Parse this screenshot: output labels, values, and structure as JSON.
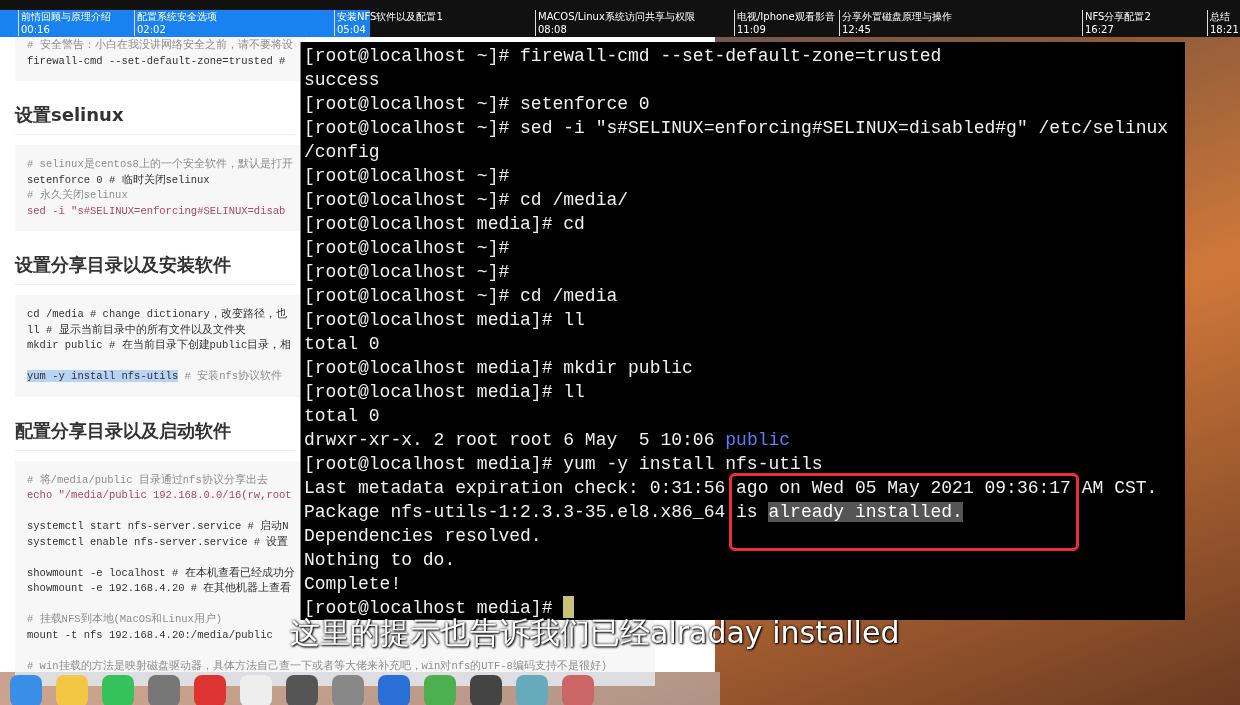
{
  "chapter_bar": {
    "level": 0.298,
    "chapters": [
      {
        "title": "前情回顾与原理介绍",
        "time": "00:16"
      },
      {
        "title": "配置系统安全选项",
        "time": "02:02"
      },
      {
        "title": "安装NFS软件以及配置1",
        "time": "05:04"
      },
      {
        "title": "MACOS/Linux系统访问共享与权限",
        "time": "08:08"
      },
      {
        "title": "电视/Iphone观看影音",
        "time": "11:09"
      },
      {
        "title": "分享外置磁盘原理与操作",
        "time": "12:45"
      },
      {
        "title": "NFS分享配置2",
        "time": "16:27"
      },
      {
        "title": "总结",
        "time": "18:21"
      }
    ]
  },
  "document": {
    "sections": [
      {
        "lines": [
          {
            "kind": "comment",
            "text": "# 安全警告：小白在我没讲网络安全之前，请不要将设",
            "selected": false
          },
          {
            "kind": "code",
            "text": "firewall-cmd --set-default-zone=trusted #",
            "selected": false
          }
        ]
      },
      {
        "heading": "设置selinux",
        "lines": [
          {
            "kind": "comment",
            "text": "# selinux是centos8上的一个安全软件，默认是打开",
            "selected": false
          },
          {
            "kind": "code",
            "text": "setenforce 0 # 临时关闭selinux",
            "selected": false
          },
          {
            "kind": "comment",
            "text": "# 永久关闭selinux",
            "selected": false
          },
          {
            "kind": "string",
            "text": "sed -i \"s#SELINUX=enforcing#SELINUX=disab",
            "selected": false
          }
        ]
      },
      {
        "heading": "设置分享目录以及安装软件",
        "lines": [
          {
            "kind": "code",
            "text": "cd /media  # change dictionary，改变路径，也",
            "selected": false
          },
          {
            "kind": "code",
            "text": "ll # 显示当前目录中的所有文件以及文件夹",
            "selected": false
          },
          {
            "kind": "code",
            "text": "mkdir public # 在当前目录下创建public目录，相",
            "selected": false
          },
          {
            "kind": "blank"
          },
          {
            "kind": "code",
            "text": "yum -y install nfs-utils",
            "tail": " # 安装nfs协议软件",
            "selected": true
          }
        ]
      },
      {
        "heading": "配置分享目录以及启动软件",
        "lines": [
          {
            "kind": "comment",
            "text": "# 将/media/public 目录通过nfs协议分享出去",
            "selected": false
          },
          {
            "kind": "string",
            "text": "echo \"/media/public 192.168.0.0/16(rw,root",
            "selected": false
          },
          {
            "kind": "blank"
          },
          {
            "kind": "code",
            "text": "systemctl start nfs-server.service # 启动N",
            "selected": false
          },
          {
            "kind": "code",
            "text": "systemctl enable nfs-server.service # 设置",
            "selected": false
          },
          {
            "kind": "blank"
          },
          {
            "kind": "code",
            "text": "showmount -e localhost # 在本机查看已经成功分",
            "selected": false
          },
          {
            "kind": "code",
            "text": "showmount -e 192.168.4.20 # 在其他机器上查看",
            "selected": false
          },
          {
            "kind": "blank"
          },
          {
            "kind": "comment",
            "text": "# 挂载NFS到本地(MacOS和Linux用户)",
            "selected": false
          },
          {
            "kind": "code",
            "text": "mount -t nfs 192.168.4.20:/media/public",
            "selected": false
          },
          {
            "kind": "blank"
          },
          {
            "kind": "comment",
            "text": "# win挂载的方法是映射磁盘驱动器，具体方法自己查一下或者等大佬来补充吧，win对nfs的UTF-8编码支持不是很好)",
            "selected": false
          }
        ]
      }
    ]
  },
  "terminal": {
    "lines": [
      {
        "text": "[root@localhost ~]# firewall-cmd --set-default-zone=trusted",
        "cursor": false
      },
      {
        "text": "success",
        "cursor": false
      },
      {
        "text": "[root@localhost ~]# setenforce 0",
        "cursor": false
      },
      {
        "text": "[root@localhost ~]# sed -i \"s#SELINUX=enforcing#SELINUX=disabled#g\" /etc/selinux",
        "cursor": false
      },
      {
        "text": "/config",
        "cursor": false
      },
      {
        "text": "[root@localhost ~]#",
        "cursor": false
      },
      {
        "text": "[root@localhost ~]# cd /media/",
        "cursor": false
      },
      {
        "text": "[root@localhost media]# cd",
        "cursor": false
      },
      {
        "text": "[root@localhost ~]#",
        "cursor": false
      },
      {
        "text": "[root@localhost ~]#",
        "cursor": false
      },
      {
        "text": "[root@localhost ~]# cd /media",
        "cursor": false
      },
      {
        "text": "[root@localhost media]# ll",
        "cursor": false
      },
      {
        "text": "total 0",
        "cursor": false
      },
      {
        "text": "[root@localhost media]# mkdir public",
        "cursor": false
      },
      {
        "text": "[root@localhost media]# ll",
        "cursor": false
      },
      {
        "text": "total 0",
        "cursor": false
      },
      {
        "text": "drwxr-xr-x. 2 root root 6 May  5 10:06 ",
        "dir_name": "public",
        "cursor": false
      },
      {
        "text": "[root@localhost media]# yum -y install nfs-utils",
        "cursor": false
      },
      {
        "text": "Last metadata expiration check: 0:31:56 ago on Wed 05 May 2021 09:36:17 AM CST.",
        "cursor": false
      },
      {
        "text": "Package nfs-utils-1:2.3.3-35.el8.x86_64 is ",
        "selected_text": "already installed.",
        "cursor": false
      },
      {
        "text": "Dependencies resolved.",
        "cursor": false
      },
      {
        "text": "Nothing to do.",
        "cursor": false
      },
      {
        "text": "Complete!",
        "cursor": false
      },
      {
        "text": "[root@localhost media]# ",
        "cursor": true
      }
    ]
  },
  "subtitle": "这里的提示也告诉我们已经alraday installed"
}
